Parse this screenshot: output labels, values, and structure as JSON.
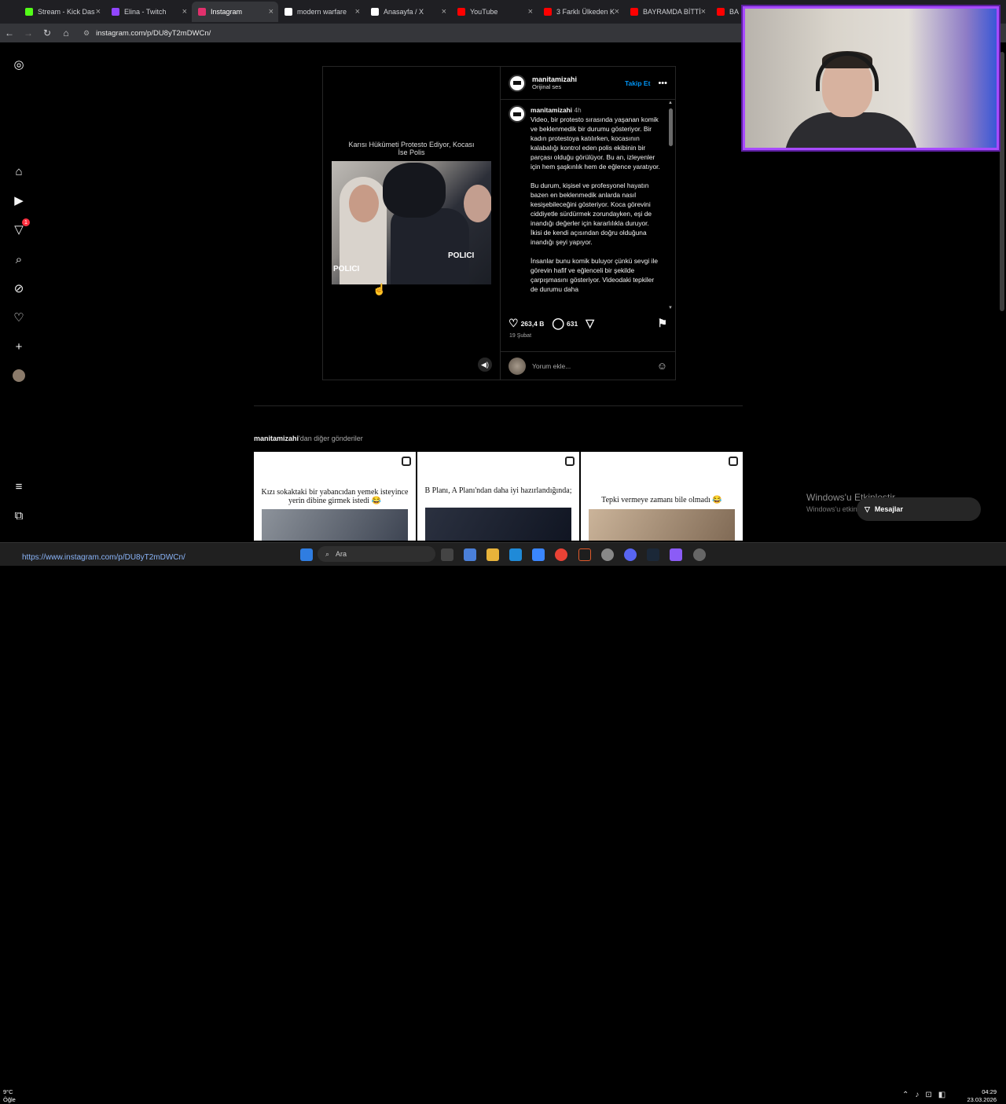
{
  "browser": {
    "tabs": [
      {
        "title": "Stream - Kick Das",
        "color": "#53fc18"
      },
      {
        "title": "Elina - Twitch",
        "color": "#9146ff"
      },
      {
        "title": "Instagram",
        "color": "#e1306c",
        "active": true
      },
      {
        "title": "modern warfare",
        "color": "#ffffff"
      },
      {
        "title": "Anasayfa / X",
        "color": "#ffffff"
      },
      {
        "title": "YouTube",
        "color": "#ff0000"
      },
      {
        "title": "3 Farklı Ülkeden K",
        "color": "#ff0000"
      },
      {
        "title": "BAYRAMDA BİTTİ",
        "color": "#ff0000"
      },
      {
        "title": "BA",
        "color": "#ff0000"
      }
    ],
    "url": "instagram.com/p/DU8yT2mDWCn/",
    "status_url": "https://www.instagram.com/p/DU8yT2mDWCn/"
  },
  "sidebar": {
    "notification_count": "1"
  },
  "post": {
    "username": "manitamizahi",
    "audio": "Orijinal ses",
    "follow_label": "Takip Et",
    "video_title": "Karısı Hükümeti Protesto Ediyor, Kocası İse Polis",
    "caption_time": "4h",
    "caption_paragraphs": [
      "Video, bir protesto sırasında yaşanan komik ve beklenmedik bir durumu gösteriyor. Bir kadın protestoya katılırken, kocasının kalabalığı kontrol eden polis ekibinin bir parçası olduğu görülüyor. Bu an, izleyenler için hem şaşkınlık hem de eğlence yaratıyor.",
      "Bu durum, kişisel ve profesyonel hayatın bazen en beklenmedik anlarda nasıl kesişebileceğini gösteriyor. Koca görevini ciddiyetle sürdürmek zorundayken, eşi de inandığı değerler için kararlılıkla duruyor. İkisi de kendi açısından doğru olduğuna inandığı şeyi yapıyor.",
      "İnsanlar bunu komik buluyor çünkü sevgi ile görevin hafif ve eğlenceli bir şekilde çarpışmasını gösteriyor. Videodaki tepkiler de durumu daha"
    ],
    "likes": "263,4 B",
    "comments": "631",
    "date": "19 Şubat",
    "comment_placeholder": "Yorum ekle..."
  },
  "more_posts": {
    "user": "manitamizahi",
    "suffix": "'dan diğer gönderiler",
    "items": [
      {
        "text": "Kızı sokaktaki bir yabancıdan yemek isteyince yerin dibine girmek istedi 😂"
      },
      {
        "text": "B Planı, A Planı'ndan daha iyi hazırlandığında;"
      },
      {
        "text": "Tepki vermeye zamanı bile olmadı 😂"
      }
    ]
  },
  "overlay": {
    "windows_activate": "Windows'u Etkinleştir",
    "windows_activate_sub": "Windows'u etkinleştirmek için Ayarlar'a gidin.",
    "messages_label": "Mesajlar"
  },
  "taskbar": {
    "search_placeholder": "Ara",
    "weather_temp": "9°C",
    "weather_text": "Öğle",
    "time": "04:29",
    "date": "23.03.2026"
  }
}
